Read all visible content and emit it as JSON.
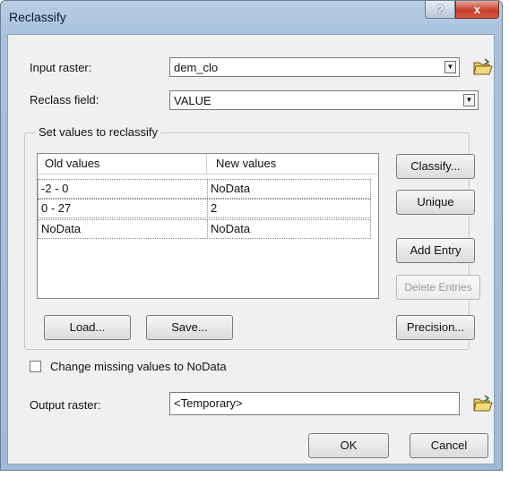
{
  "window": {
    "title": "Reclassify",
    "help_icon": "?",
    "close_icon": "x"
  },
  "input_raster": {
    "label": "Input raster:",
    "value": "dem_clo"
  },
  "reclass_field": {
    "label": "Reclass field:",
    "value": "VALUE"
  },
  "group": {
    "label": "Set values to reclassify"
  },
  "table": {
    "headers": [
      "Old values",
      "New values"
    ],
    "rows": [
      {
        "old": "-2 - 0",
        "new": "NoData"
      },
      {
        "old": "0 - 27",
        "new": "2"
      },
      {
        "old": "NoData",
        "new": "NoData"
      }
    ]
  },
  "buttons": {
    "classify": "Classify...",
    "unique": "Unique",
    "add_entry": "Add Entry",
    "delete_entries": "Delete Entries",
    "load": "Load...",
    "save": "Save...",
    "precision": "Precision...",
    "ok": "OK",
    "cancel": "Cancel"
  },
  "missing_nodata": {
    "label": "Change missing values to NoData",
    "checked": false
  },
  "output_raster": {
    "label": "Output raster:",
    "value": "<Temporary>"
  },
  "icons": {
    "folder": "open-folder-icon",
    "dropdown": "chevron-down-icon"
  }
}
